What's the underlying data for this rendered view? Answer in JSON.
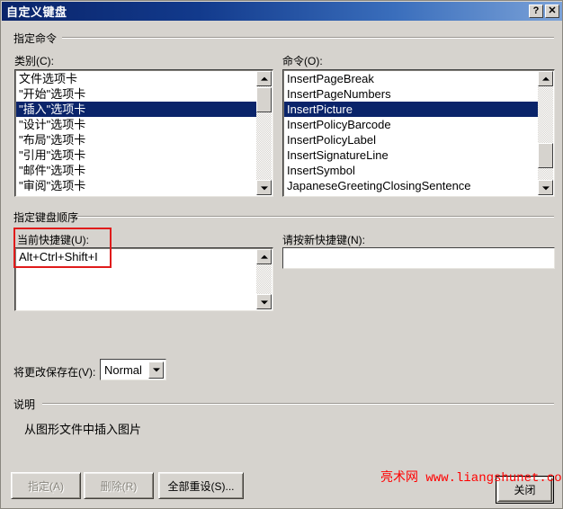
{
  "window": {
    "title": "自定义键盘",
    "help_button": "?",
    "close_button": "✕"
  },
  "groups": {
    "specify_command": "指定命令",
    "specify_keyboard_order": "指定键盘顺序",
    "description": "说明"
  },
  "categories": {
    "label": "类别(C):",
    "items": [
      {
        "text": "文件选项卡",
        "selected": false
      },
      {
        "text": "\"开始\"选项卡",
        "selected": false
      },
      {
        "text": "\"插入\"选项卡",
        "selected": true
      },
      {
        "text": "\"设计\"选项卡",
        "selected": false
      },
      {
        "text": "\"布局\"选项卡",
        "selected": false
      },
      {
        "text": "\"引用\"选项卡",
        "selected": false
      },
      {
        "text": "\"邮件\"选项卡",
        "selected": false
      },
      {
        "text": "\"审阅\"选项卡",
        "selected": false
      }
    ]
  },
  "commands": {
    "label": "命令(O):",
    "items": [
      {
        "text": "InsertPageBreak",
        "selected": false
      },
      {
        "text": "InsertPageNumbers",
        "selected": false
      },
      {
        "text": "InsertPicture",
        "selected": true
      },
      {
        "text": "InsertPolicyBarcode",
        "selected": false
      },
      {
        "text": "InsertPolicyLabel",
        "selected": false
      },
      {
        "text": "InsertSignatureLine",
        "selected": false
      },
      {
        "text": "InsertSymbol",
        "selected": false
      },
      {
        "text": "JapaneseGreetingClosingSentence",
        "selected": false
      }
    ]
  },
  "current_keys": {
    "label": "当前快捷键(U):",
    "items": [
      {
        "text": "Alt+Ctrl+Shift+I",
        "selected": false
      }
    ]
  },
  "new_key": {
    "label": "请按新快捷键(N):",
    "value": "",
    "placeholder": ""
  },
  "save_in": {
    "label": "将更改保存在(V):",
    "value": "Normal",
    "options": [
      "Normal"
    ]
  },
  "description": {
    "text": "从图形文件中插入图片"
  },
  "buttons": {
    "assign": {
      "label": "指定(A)",
      "disabled": true
    },
    "remove": {
      "label": "删除(R)",
      "disabled": true
    },
    "reset_all": {
      "label": "全部重设(S)...",
      "disabled": false
    },
    "close": {
      "label": "关闭",
      "disabled": false,
      "is_default": true
    }
  },
  "watermark": {
    "text": "亮术网 www.liangshunet.com",
    "color": "#ff0000"
  },
  "colors": {
    "dialog_face": "#d6d3ce",
    "title_start": "#0a246a",
    "title_end": "#7ba2d8",
    "selection": "#0a246a",
    "annotation": "#e01b1b"
  }
}
